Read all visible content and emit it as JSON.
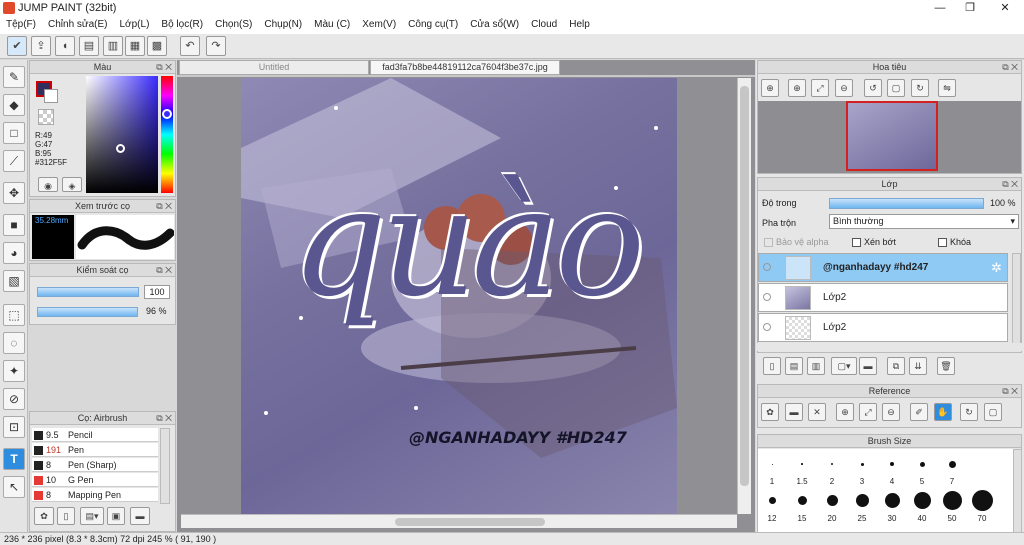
{
  "app": {
    "title": "JUMP PAINT (32bit)"
  },
  "menu": [
    "Tệp(F)",
    "Chỉnh sửa(E)",
    "Lớp(L)",
    "Bộ lọc(R)",
    "Chọn(S)",
    "Chụp(N)",
    "Màu (C)",
    "Xem(V)",
    "Công cụ(T)",
    "Cửa sổ(W)",
    "Cloud",
    "Help"
  ],
  "window_controls": {
    "minimize": "—",
    "maximize": "❐",
    "close": "✕"
  },
  "color_panel": {
    "title": "Màu",
    "r": "R:49",
    "g": "G:47",
    "b": "B:95",
    "hex": "#312F5F",
    "fg": "#312F5F",
    "bg": "#ffffff"
  },
  "brush_preview": {
    "title": "Xem trước cọ",
    "size": "35.28mm"
  },
  "brush_control": {
    "title": "Kiểm soát cọ",
    "size_value": "100",
    "opacity_value": "96 %"
  },
  "brush_list": {
    "title": "Cọ: Airbrush",
    "items": [
      {
        "size": "9.5",
        "name": "Pencil",
        "size_color": "#222",
        "swatch": "#222"
      },
      {
        "size": "191",
        "name": "Pen",
        "size_color": "#c0392b",
        "swatch": "#222"
      },
      {
        "size": "8",
        "name": "Pen (Sharp)",
        "size_color": "#222",
        "swatch": "#222"
      },
      {
        "size": "10",
        "name": "G Pen",
        "size_color": "#222",
        "swatch": "#e53935"
      },
      {
        "size": "8",
        "name": "Mapping Pen",
        "size_color": "#222",
        "swatch": "#e53935"
      }
    ]
  },
  "tabs": {
    "untitled": "Untitled",
    "file": "fad3fa7b8be44819112ca7604f3be37c.jpg"
  },
  "artwork": {
    "script_text": "quào",
    "handle": "@NGANHADAYY #HD247"
  },
  "navigator": {
    "title": "Hoa tiêu"
  },
  "layer_panel": {
    "title": "Lớp",
    "opacity_label": "Độ trong",
    "opacity_value": "100 %",
    "blend_label": "Pha trộn",
    "blend_value": "Bình thường",
    "protect_alpha": "Bảo vệ alpha",
    "clipping": "Xén bớt",
    "lock": "Khóa",
    "layers": [
      {
        "name": "@nganhadayy #hd247",
        "selected": true
      },
      {
        "name": "Lớp2",
        "selected": false
      },
      {
        "name": "Lớp2",
        "selected": false
      }
    ]
  },
  "reference": {
    "title": "Reference"
  },
  "brush_size": {
    "title": "Brush Size",
    "row1": [
      "1",
      "1.5",
      "2",
      "3",
      "4",
      "5",
      "7"
    ],
    "row2": [
      "12",
      "15",
      "20",
      "25",
      "30",
      "40",
      "50",
      "70"
    ]
  },
  "status": {
    "text": "236 * 236 pixel   (8.3 * 8.3cm)   72 dpi   245 %   ( 91, 190 )"
  }
}
